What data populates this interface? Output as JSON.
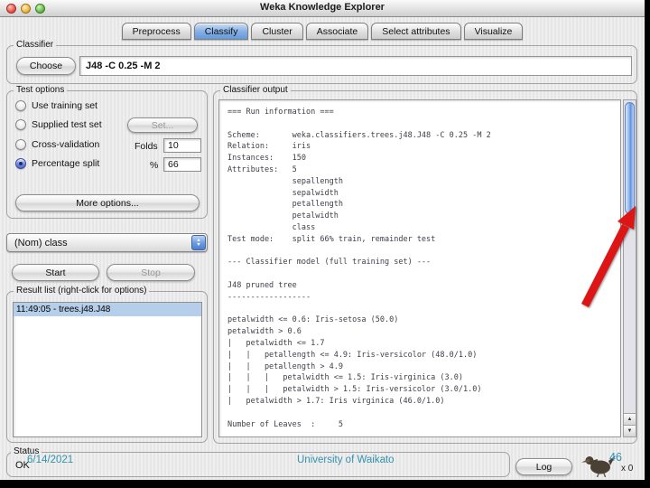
{
  "window": {
    "title": "Weka Knowledge Explorer"
  },
  "tabs": [
    {
      "label": "Preprocess",
      "active": false
    },
    {
      "label": "Classify",
      "active": true
    },
    {
      "label": "Cluster",
      "active": false
    },
    {
      "label": "Associate",
      "active": false
    },
    {
      "label": "Select attributes",
      "active": false
    },
    {
      "label": "Visualize",
      "active": false
    }
  ],
  "classifier": {
    "group_label": "Classifier",
    "choose_button": "Choose",
    "scheme": "J48 -C 0.25 -M 2"
  },
  "test_options": {
    "group_label": "Test options",
    "use_training_set": {
      "label": "Use training set",
      "selected": false
    },
    "supplied_test_set": {
      "label": "Supplied test set",
      "selected": false,
      "set_button": "Set..."
    },
    "cross_validation": {
      "label": "Cross-validation",
      "selected": false,
      "folds_label": "Folds",
      "folds_value": "10"
    },
    "percentage_split": {
      "label": "Percentage split",
      "selected": true,
      "percent_label": "%",
      "percent_value": "66"
    },
    "more_options_button": "More options..."
  },
  "class_selector": {
    "value": "(Nom) class"
  },
  "run_controls": {
    "start_button": "Start",
    "stop_button": "Stop",
    "stop_enabled": false
  },
  "result_list": {
    "group_label": "Result list (right-click for options)",
    "items": [
      {
        "label": "11:49:05 - trees.j48.J48",
        "selected": true
      }
    ]
  },
  "classifier_output": {
    "group_label": "Classifier output",
    "text": "=== Run information ===\n\nScheme:       weka.classifiers.trees.j48.J48 -C 0.25 -M 2\nRelation:     iris\nInstances:    150\nAttributes:   5\n              sepallength\n              sepalwidth\n              petallength\n              petalwidth\n              class\nTest mode:    split 66% train, remainder test\n\n--- Classifier model (full training set) ---\n\nJ48 pruned tree\n------------------\n\npetalwidth <= 0.6: Iris-setosa (50.0)\npetalwidth > 0.6\n|   petalwidth <= 1.7\n|   |   petallength <= 4.9: Iris-versicolor (48.0/1.0)\n|   |   petallength > 4.9\n|   |   |   petalwidth <= 1.5: Iris-virginica (3.0)\n|   |   |   petalwidth > 1.5: Iris-versicolor (3.0/1.0)\n|   petalwidth > 1.7: Iris virginica (46.0/1.0)\n\nNumber of Leaves  :     5"
  },
  "status_bar": {
    "group_label": "Status",
    "status": "OK",
    "log_button": "Log",
    "weka_counter": "x 0"
  },
  "slide_overlay": {
    "date": "6/14/2021",
    "footer": "University of Waikato",
    "slide_number": "46"
  },
  "icons": {
    "arrow_up": "▲",
    "arrow_down": "▼"
  },
  "colors": {
    "active_tab": "#649ade",
    "selection": "#b5cee9",
    "scroll_thumb": "#5e90e0",
    "annotation_arrow": "#dd1515",
    "overlay_text": "#3492ac"
  }
}
